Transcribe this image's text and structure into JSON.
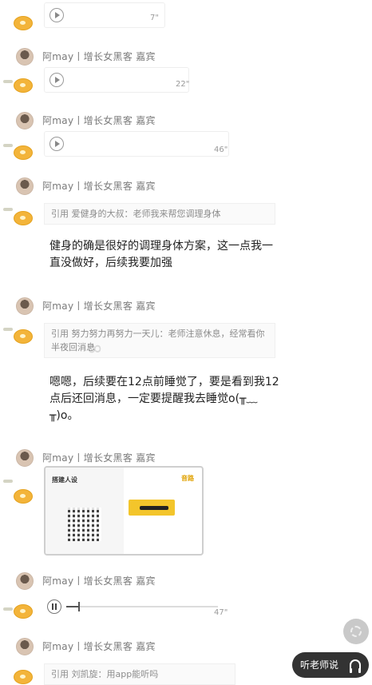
{
  "sender_name": "阿may丨增长女黑客 嘉宾",
  "messages": [
    {
      "type": "voice",
      "duration": "7\""
    },
    {
      "type": "voice",
      "duration": "22\""
    },
    {
      "type": "voice",
      "duration": "46\""
    },
    {
      "type": "text",
      "quote": "引用 爱健身的大叔：老师我来帮您调理身体",
      "text": "健身的确是很好的调理身体方案，这一点我一直没做好，后续我要加强"
    },
    {
      "type": "text",
      "quote": "引用 努力努力再努力一天儿：老师注意休息，经常看你半夜回消息",
      "text": "嗯嗯，后续要在12点前睡觉了，要是看到我12点后还回消息，一定要提醒我去睡觉o(╥﹏╥)o。"
    },
    {
      "type": "image",
      "img_title": "搭建人设",
      "img_brand": "音路"
    },
    {
      "type": "audio",
      "duration": "47\"",
      "progress": 0.08
    },
    {
      "type": "text",
      "quote": "引用 刘凯旋：用app能听吗"
    }
  ],
  "fab_label": "听老师说",
  "fab_icon": "headphones-icon",
  "watermark": "8"
}
